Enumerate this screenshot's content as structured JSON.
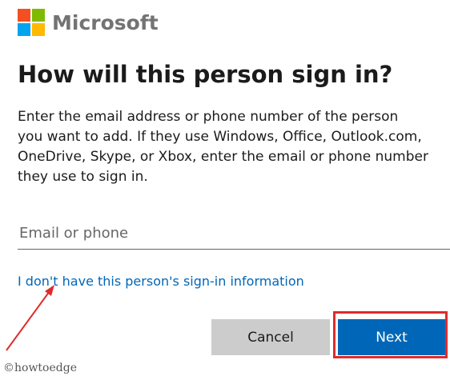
{
  "brand": {
    "name": "Microsoft",
    "colors": {
      "red": "#f25022",
      "green": "#7fba00",
      "blue": "#00a4ef",
      "yellow": "#ffb900"
    }
  },
  "dialog": {
    "title": "How will this person sign in?",
    "description_lines": [
      "Enter the email address or phone number of the person",
      "you want to add. If they use Windows, Office, Outlook.com,",
      "OneDrive, Skype, or Xbox, enter the email or phone number",
      "they use to sign in."
    ],
    "email_input": {
      "placeholder": "Email or phone",
      "value": ""
    },
    "no_info_link": "I don't have this person's sign-in information",
    "buttons": {
      "cancel_label": "Cancel",
      "next_label": "Next"
    },
    "accent_color": "#0067b8"
  },
  "annotations": {
    "highlight_color": "#e02b2b",
    "watermark": "©howtoedge"
  }
}
